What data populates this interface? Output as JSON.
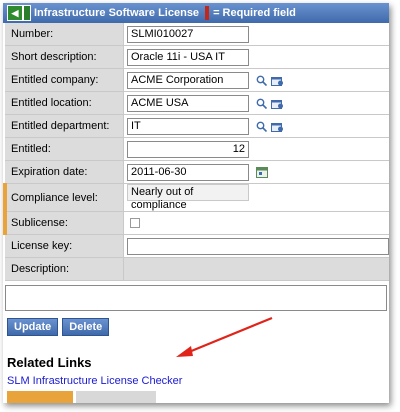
{
  "title": "Infrastructure Software License",
  "required_hint": "= Required field",
  "fields": {
    "number": {
      "label": "Number:",
      "value": "SLMI010027"
    },
    "short_description": {
      "label": "Short description:",
      "value": "Oracle 11i - USA IT"
    },
    "entitled_company": {
      "label": "Entitled company:",
      "value": "ACME Corporation"
    },
    "entitled_location": {
      "label": "Entitled location:",
      "value": "ACME USA"
    },
    "entitled_department": {
      "label": "Entitled department:",
      "value": "IT"
    },
    "entitled": {
      "label": "Entitled:",
      "value": "12"
    },
    "expiration_date": {
      "label": "Expiration date:",
      "value": "2011-06-30"
    },
    "compliance_level": {
      "label": "Compliance level:",
      "value": "Nearly out of compliance"
    },
    "sublicense": {
      "label": "Sublicense:"
    },
    "license_key": {
      "label": "License key:",
      "value": ""
    },
    "description": {
      "label": "Description:",
      "value": ""
    }
  },
  "buttons": {
    "update": "Update",
    "delete": "Delete"
  },
  "related": {
    "heading": "Related Links",
    "link": "SLM Infrastructure License Checker"
  },
  "colors": {
    "header": "#3f6aab",
    "required": "#e8a33a",
    "arrow": "#e0241a"
  }
}
